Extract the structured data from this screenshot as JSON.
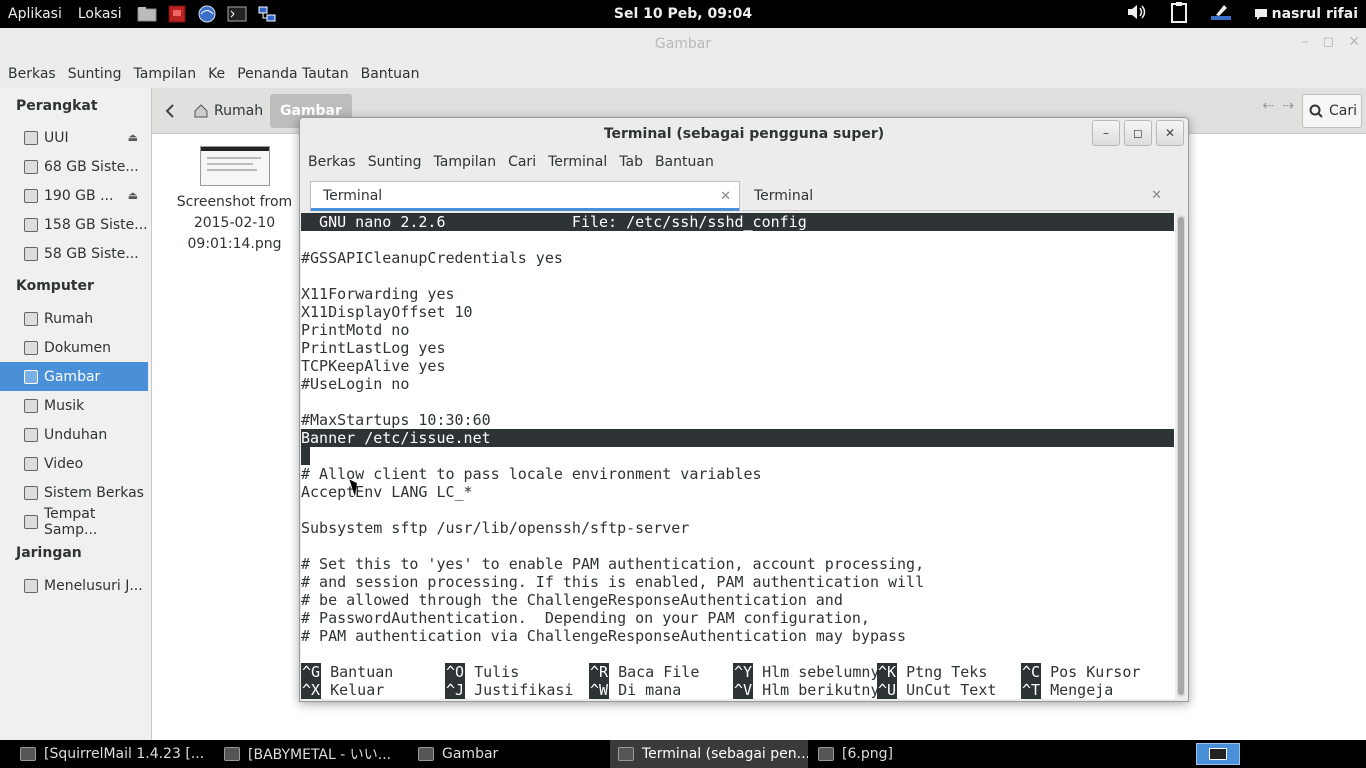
{
  "top_panel": {
    "apps_label": "Aplikasi",
    "places_label": "Lokasi",
    "launcher_icons": [
      "file-manager-icon",
      "pdf-app-icon",
      "web-browser-icon",
      "terminal-icon",
      "network-tool-icon"
    ],
    "clock": "Sel 10 Peb, 09:04",
    "user": "nasrul rifai",
    "user_icon": "chat-bubble-icon"
  },
  "file_manager": {
    "title": "Gambar",
    "menu": [
      "Berkas",
      "Sunting",
      "Tampilan",
      "Ke",
      "Penanda Tautan",
      "Bantuan"
    ],
    "breadcrumb": {
      "home": "Rumah",
      "current": "Gambar"
    },
    "search_label": "Cari",
    "sidebar": {
      "devices_heading": "Perangkat",
      "devices": [
        {
          "label": "UUI",
          "eject": true
        },
        {
          "label": "68 GB Siste...",
          "eject": false
        },
        {
          "label": "190 GB ...",
          "eject": true
        },
        {
          "label": "158 GB Siste...",
          "eject": false
        },
        {
          "label": "58 GB Siste...",
          "eject": false
        }
      ],
      "computer_heading": "Komputer",
      "computer": [
        {
          "label": "Rumah",
          "active": false
        },
        {
          "label": "Dokumen",
          "active": false
        },
        {
          "label": "Gambar",
          "active": true
        },
        {
          "label": "Musik",
          "active": false
        },
        {
          "label": "Unduhan",
          "active": false
        },
        {
          "label": "Video",
          "active": false
        },
        {
          "label": "Sistem Berkas",
          "active": false
        },
        {
          "label": "Tempat Samp...",
          "active": false
        }
      ],
      "network_heading": "Jaringan",
      "network": [
        {
          "label": "Menelusuri J..."
        }
      ]
    },
    "file": {
      "name_lines": [
        "Screenshot from",
        "2015-02-10",
        "09:01:14.png"
      ]
    }
  },
  "terminal": {
    "title": "Terminal (sebagai pengguna super)",
    "menu": [
      "Berkas",
      "Sunting",
      "Tampilan",
      "Cari",
      "Terminal",
      "Tab",
      "Bantuan"
    ],
    "tabs": [
      {
        "label": "Terminal",
        "active": true
      },
      {
        "label": "Terminal",
        "active": false
      }
    ],
    "nano_header": "  GNU nano 2.2.6              File: /etc/ssh/sshd_config",
    "lines": [
      "",
      "#GSSAPICleanupCredentials yes",
      "",
      "X11Forwarding yes",
      "X11DisplayOffset 10",
      "PrintMotd no",
      "PrintLastLog yes",
      "TCPKeepAlive yes",
      "#UseLogin no",
      "",
      "#MaxStartups 10:30:60",
      "Banner /etc/issue.net",
      "",
      "# Allow client to pass locale environment variables",
      "AcceptEnv LANG LC_*",
      "",
      "Subsystem sftp /usr/lib/openssh/sftp-server",
      "",
      "# Set this to 'yes' to enable PAM authentication, account processing,",
      "# and session processing. If this is enabled, PAM authentication will",
      "# be allowed through the ChallengeResponseAuthentication and",
      "# PasswordAuthentication.  Depending on your PAM configuration,",
      "# PAM authentication via ChallengeResponseAuthentication may bypass"
    ],
    "highlighted_line": "Banner /etc/issue.net",
    "shortcuts_row1": [
      {
        "key": "^G",
        "label": " Bantuan"
      },
      {
        "key": "^O",
        "label": " Tulis"
      },
      {
        "key": "^R",
        "label": " Baca File"
      },
      {
        "key": "^Y",
        "label": " Hlm sebelumny"
      },
      {
        "key": "^K",
        "label": " Ptng Teks"
      },
      {
        "key": "^C",
        "label": " Pos Kursor"
      }
    ],
    "shortcuts_row2": [
      {
        "key": "^X",
        "label": " Keluar"
      },
      {
        "key": "^J",
        "label": " Justifikasi"
      },
      {
        "key": "^W",
        "label": " Di mana"
      },
      {
        "key": "^V",
        "label": " Hlm berikutny"
      },
      {
        "key": "^U",
        "label": " UnCut Text"
      },
      {
        "key": "^T",
        "label": " Mengeja"
      }
    ]
  },
  "taskbar": {
    "tasks": [
      {
        "label": "[SquirrelMail 1.4.23 [...",
        "icon": "browser-icon",
        "active": false
      },
      {
        "label": "[BABYMETAL - いい...",
        "icon": "media-icon",
        "active": false
      },
      {
        "label": "Gambar",
        "icon": "folder-icon",
        "active": false
      },
      {
        "label": "Terminal (sebagai pen...",
        "icon": "terminal-icon",
        "active": true
      },
      {
        "label": "[6.png]",
        "icon": "image-icon",
        "active": false
      }
    ]
  },
  "colors": {
    "accent": "#4a90d9",
    "panel": "#000000",
    "terminal_text": "#2e3436"
  }
}
